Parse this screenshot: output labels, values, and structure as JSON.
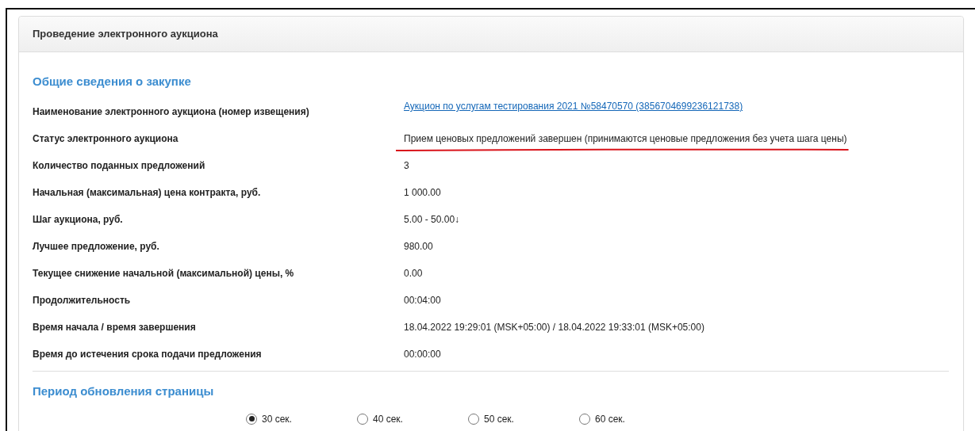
{
  "panel": {
    "title": "Проведение электронного аукциона"
  },
  "sections": [
    {
      "title": "Общие сведения о закупке",
      "rows": [
        {
          "label": "Наименование электронного аукциона (номер извещения)",
          "value": "Аукцион по услугам тестирования 2021 №58470570 (3856704699236121738)",
          "kind": "link",
          "underlined": false
        },
        {
          "label": "Статус электронного аукциона",
          "value": "Прием ценовых предложений завершен (принимаются ценовые предложения без учета шага цены)",
          "kind": "text",
          "underlined": true
        },
        {
          "label": "Количество поданных предложений",
          "value": "3",
          "kind": "text",
          "underlined": false
        },
        {
          "label": "Начальная (максимальная) цена контракта, руб.",
          "value": "1 000.00",
          "kind": "text",
          "underlined": false
        },
        {
          "label": "Шаг аукциона, руб.",
          "value": "5.00 - 50.00↓",
          "kind": "text",
          "underlined": false
        },
        {
          "label": "Лучшее предложение, руб.",
          "value": "980.00",
          "kind": "text",
          "underlined": false
        },
        {
          "label": "Текущее снижение начальной (максимальной) цены, %",
          "value": "0.00",
          "kind": "text",
          "underlined": false
        },
        {
          "label": "Продолжительность",
          "value": "00:04:00",
          "kind": "text",
          "underlined": false
        },
        {
          "label": "Время начала / время завершения",
          "value": "18.04.2022 19:29:01 (MSK+05:00) / 18.04.2022 19:33:01 (MSK+05:00)",
          "kind": "text",
          "underlined": false
        },
        {
          "label": "Время до истечения срока подачи предложения",
          "value": "00:00:00",
          "kind": "text",
          "underlined": false
        }
      ]
    },
    {
      "title": "Период обновления страницы",
      "options": [
        {
          "label": "30 сек.",
          "selected": true
        },
        {
          "label": "40 сек.",
          "selected": false
        },
        {
          "label": "50 сек.",
          "selected": false
        },
        {
          "label": "60 сек.",
          "selected": false
        }
      ]
    }
  ]
}
